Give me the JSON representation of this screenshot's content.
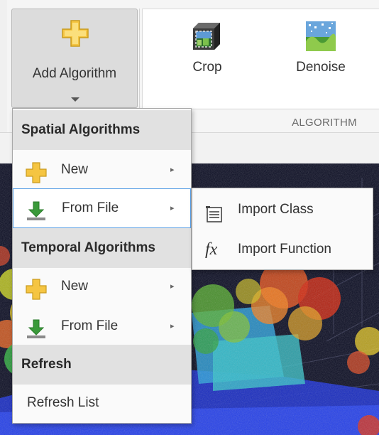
{
  "toolstrip": {
    "add_algorithm_label": "Add Algorithm",
    "algorithm_section_caption": "ALGORITHM",
    "tiles": [
      {
        "label": "Crop",
        "icon": "crop-icon"
      },
      {
        "label": "Denoise",
        "icon": "denoise-icon"
      }
    ]
  },
  "menu": {
    "spatial_header": "Spatial Algorithms",
    "spatial_new": "New",
    "spatial_from_file": "From File",
    "temporal_header": "Temporal Algorithms",
    "temporal_new": "New",
    "temporal_from_file": "From File",
    "refresh_header": "Refresh",
    "refresh_list": "Refresh List"
  },
  "submenu": {
    "import_class": "Import Class",
    "import_function": "Import Function",
    "fx_symbol": "fx"
  },
  "colors": {
    "accent_plus": "#f5c542",
    "download_arrow": "#3a9a3a",
    "selection_border": "#5aa0e6",
    "viewer_background": "#0a0c22"
  }
}
